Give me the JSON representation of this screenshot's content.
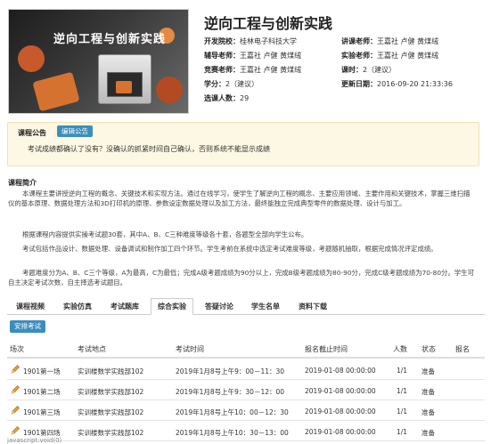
{
  "banner": {
    "title": "逆向工程与创新实践"
  },
  "course": {
    "title": "逆向工程与创新实践",
    "school_label": "开发院校：",
    "school": "桂林电子科技大学",
    "lecturer_label": "讲课老师：",
    "lecturer": "王嘉社  卢健  黄煤绒",
    "tutor_label": "辅导老师：",
    "tutor": "王嘉社  卢健  黄煤绒",
    "lab_label": "实验老师：",
    "lab": "王嘉社  卢健  黄煤绒",
    "contest_label": "竞赛老师：",
    "contest": "王嘉社  卢健  黄煤绒",
    "hours_label": "课时：",
    "hours": "2（建议）",
    "credit_label": "学分：",
    "credit": "2（建议）",
    "updated_label": "更新日期：",
    "updated": "2016-09-20 21:33:36",
    "enrolled_label": "选课人数：",
    "enrolled": "29"
  },
  "notice": {
    "label": "课程公告",
    "edit_button": "编辑公告",
    "text": "考试成绩都确认了没有？没确认的抓紧时间自己确认，否则系统不能显示成绩"
  },
  "intro": {
    "title": "课程简介",
    "p1": "本课程主要讲授逆向工程的概念、关键技术和实现方法。通过在线学习，使学生了解逆向工程的概念、主要应用领域、主要作用和关键技术，掌握三维扫描仪的基本原理、数据处理方法和3D打印机的原理、参数设定数据处理以及加工方法，最终能独立完成典型零件的数据处理、设计与加工。",
    "p2": "根据课程内容提供实操考试题30套，其中A、B、C三种难度等级各十套，各题型全部向学生公布。",
    "p3": "考试包括作品设计、数据处理、设备调试和制作加工四个环节。学生考前在系统中选定考试难度等级，考题随机抽取，根据完成情况评定成绩。",
    "p4": "考题难度分为A、B、C三个等级，A为最高，C为最低；完成A级考题成绩为90分以上，完成B级考题成绩为80-90分，完成C级考题成绩为70-80分。学生可自主决定考试次数，自主择选考试题目。"
  },
  "tabs": [
    "课程视频",
    "实验仿真",
    "考试题库",
    "综合实验",
    "答疑讨论",
    "学生名单",
    "资料下载"
  ],
  "active_tab": "综合实验",
  "arrange_button": "安排考试",
  "table": {
    "headers": [
      "场次",
      "考试地点",
      "考试时间",
      "报名截止时间",
      "人数",
      "状态",
      "报名"
    ],
    "rows": [
      [
        "1901第一场",
        "实训楼数学实践部102",
        "2019年1月8号上午9：00－11：30",
        "2019-01-08 00:00:00",
        "1/1",
        "准备",
        ""
      ],
      [
        "1901第二场",
        "实训楼数学实践部102",
        "2019年1月8号上午9：30－12：00",
        "2019-01-08 00:00:00",
        "1/1",
        "准备",
        ""
      ],
      [
        "1901第三场",
        "实训楼数学实践部102",
        "2019年1月8号上午10：00－12：30",
        "2019-01-08 00:00:00",
        "1/1",
        "准备",
        ""
      ],
      [
        "1901第四场",
        "实训楼数学实践部102",
        "2019年1月8号上午10：30－13：00",
        "2019-01-08 00:00:00",
        "1/1",
        "准备",
        ""
      ]
    ]
  },
  "status_bar": "javascript:void(0)"
}
